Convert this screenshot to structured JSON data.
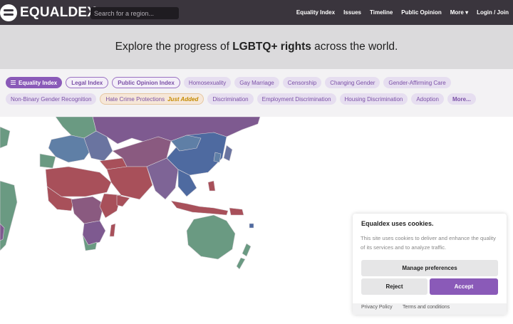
{
  "nav": {
    "logo_text": "EQUALDEX",
    "search_placeholder": "Search for a region...",
    "links": [
      "Equality Index",
      "Issues",
      "Timeline",
      "Public Opinion",
      "More ▾",
      "Login / Join"
    ]
  },
  "hero": {
    "text_before": "Explore the progress of ",
    "text_bold": "LGBTQ+ rights",
    "text_after": " across the world."
  },
  "filters": {
    "row1": [
      "Equality Index",
      "Legal Index",
      "Public Opinion Index",
      "Homosexuality",
      "Gay Marriage",
      "Censorship",
      "Changing Gender",
      "Gender-Affirming Care"
    ],
    "row2": [
      "Non-Binary Gender Recognition",
      "Hate Crime Protections",
      "Discrimination",
      "Employment Discrimination",
      "Housing Discrimination",
      "Adoption",
      "More..."
    ],
    "hate_tag": "Just Added"
  },
  "map": {
    "colors": {
      "red": "#a8505a",
      "blue": "#4e6aa0",
      "green": "#6a9a82",
      "purple": "#7e5a90",
      "border": "#d8d3d8"
    }
  },
  "cookie": {
    "title": "Equaldex uses cookies.",
    "body": "This site uses cookies to deliver and enhance the quality of its services and to analyze traffic.",
    "manage_label": "Manage preferences",
    "reject_label": "Reject",
    "accept_label": "Accept",
    "privacy_label": "Privacy Policy",
    "terms_label": "Terms and conditions"
  }
}
